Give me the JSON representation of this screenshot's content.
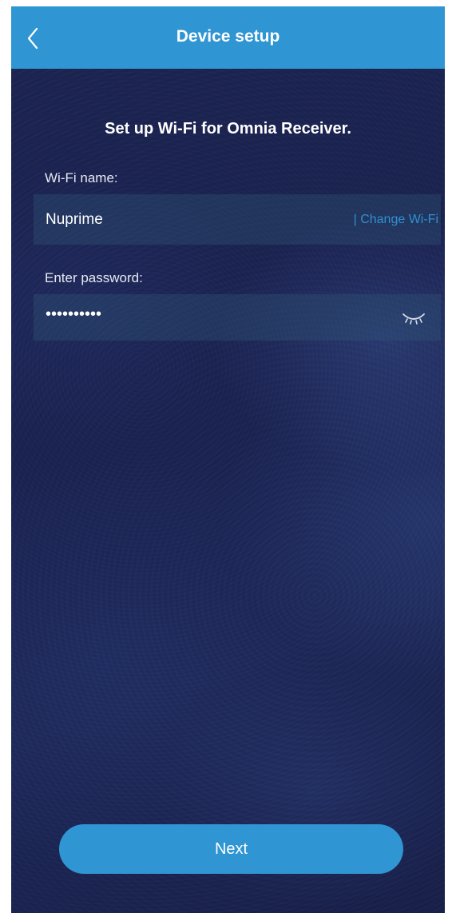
{
  "header": {
    "title": "Device setup",
    "back_icon": "chevron-left-icon"
  },
  "subtitle": "Set up Wi-Fi for Omnia Receiver.",
  "wifi": {
    "label": "Wi-Fi name:",
    "value": "Nuprime",
    "change_label": "| Change Wi-Fi"
  },
  "password": {
    "label": "Enter password:",
    "value": "••••••••••",
    "toggle_icon": "eye-closed-icon"
  },
  "footer": {
    "next_label": "Next"
  },
  "colors": {
    "accent": "#2f95d3",
    "background": "#1c2452",
    "link": "#2f8fd0"
  }
}
